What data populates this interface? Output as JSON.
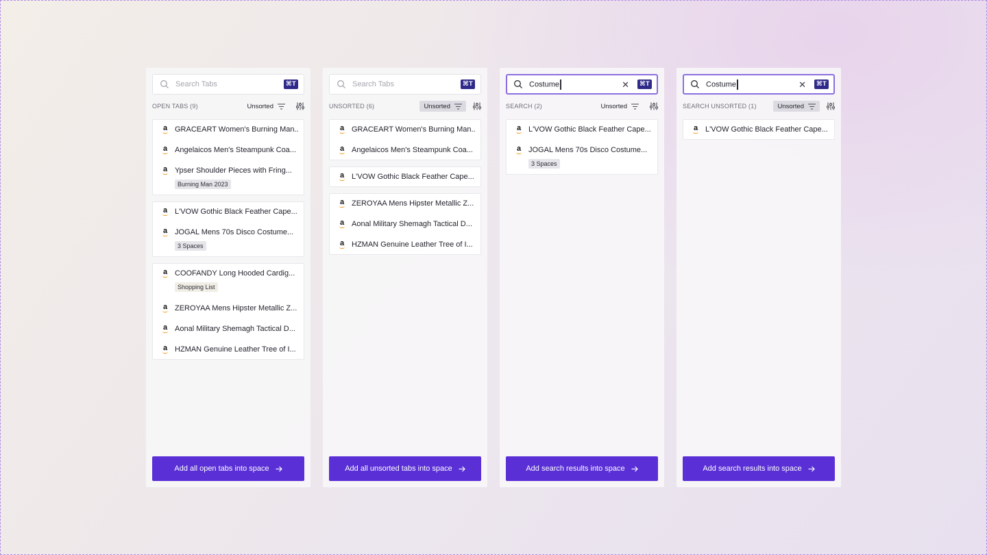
{
  "panels": [
    {
      "search": {
        "value": "",
        "placeholder": "Search Tabs",
        "shortcut": "⌘T"
      },
      "header": {
        "title": "OPEN TABS (9)",
        "sort": "Unsorted"
      },
      "cards": [
        [
          "GRACEART Women's Burning Man...",
          "Angelaicos Men's Steampunk Coa...",
          "Ypser Shoulder Pieces with Fring..."
        ],
        [
          "L'VOW Gothic Black Feather Cape...",
          "JOGAL Mens 70s Disco Costume..."
        ],
        [
          "COOFANDY Long Hooded Cardig...",
          "ZEROYAA Mens Hipster Metallic Z...",
          "Aonal Military Shemagh Tactical D...",
          "HZMAN Genuine Leather Tree of I..."
        ]
      ],
      "tags": {
        "burning_man": "Burning Man 2023",
        "spaces": "3 Spaces",
        "shopping": "Shopping List"
      },
      "button": "Add all open tabs into space"
    },
    {
      "search": {
        "value": "",
        "placeholder": "Search Tabs",
        "shortcut": "⌘T"
      },
      "header": {
        "title": "UNSORTED (6)",
        "sort": "Unsorted"
      },
      "cards": [
        [
          "GRACEART Women's Burning Man...",
          "Angelaicos Men's Steampunk Coa..."
        ],
        [
          "L'VOW Gothic Black Feather Cape..."
        ],
        [
          "ZEROYAA Mens Hipster Metallic Z...",
          "Aonal Military Shemagh Tactical D...",
          "HZMAN Genuine Leather Tree of I..."
        ]
      ],
      "button": "Add all unsorted tabs into space"
    },
    {
      "search": {
        "value": "Costume",
        "placeholder": "",
        "shortcut": "⌘T"
      },
      "header": {
        "title": "SEARCH (2)",
        "sort": "Unsorted"
      },
      "cards": [
        [
          "L'VOW Gothic Black Feather Cape...",
          "JOGAL Mens 70s Disco Costume..."
        ]
      ],
      "tags": {
        "spaces": "3 Spaces"
      },
      "button": "Add search results into space"
    },
    {
      "search": {
        "value": "Costume",
        "placeholder": "",
        "shortcut": "⌘T"
      },
      "header": {
        "title": "SEARCH UNSORTED (1)",
        "sort": "Unsorted"
      },
      "cards": [
        [
          "L'VOW Gothic Black Feather Cape..."
        ]
      ],
      "button": "Add search results into space"
    }
  ],
  "icons": {
    "search": "search-icon",
    "sort": "sort-lines-icon",
    "filter": "sliders-icon",
    "clear": "close-icon",
    "site": "amazon-logo-icon",
    "arrow": "arrow-right-icon"
  },
  "colors": {
    "accent": "#5a2fd6",
    "focus_border": "#8a6ee0",
    "kbd": "#2f2a8a"
  }
}
